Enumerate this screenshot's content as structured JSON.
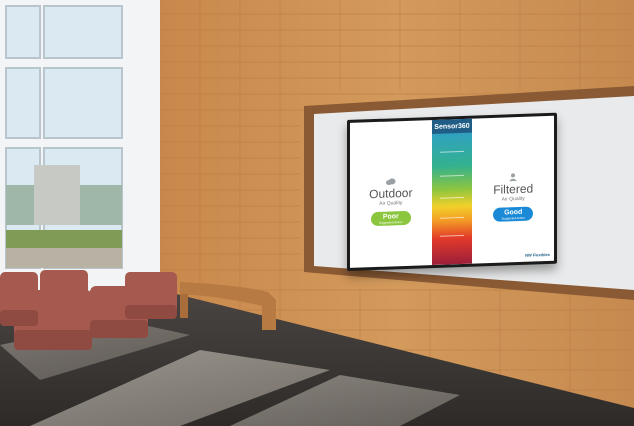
{
  "display": {
    "brand": "Sensor360",
    "outdoor": {
      "title": "Outdoor",
      "subtitle": "Air Quality",
      "status": "Poor",
      "status_sub": "Suggested Action"
    },
    "filtered": {
      "title": "Filtered",
      "subtitle": "Air Quality",
      "status": "Good",
      "status_sub": "Suggested Action"
    },
    "logo": "NW Flexibles"
  },
  "colors": {
    "poor": "#8cc63f",
    "good": "#1b8ad6",
    "brand": "#1f5d86"
  },
  "icons": {
    "outdoor": "cloud-icon",
    "filtered": "person-icon"
  }
}
